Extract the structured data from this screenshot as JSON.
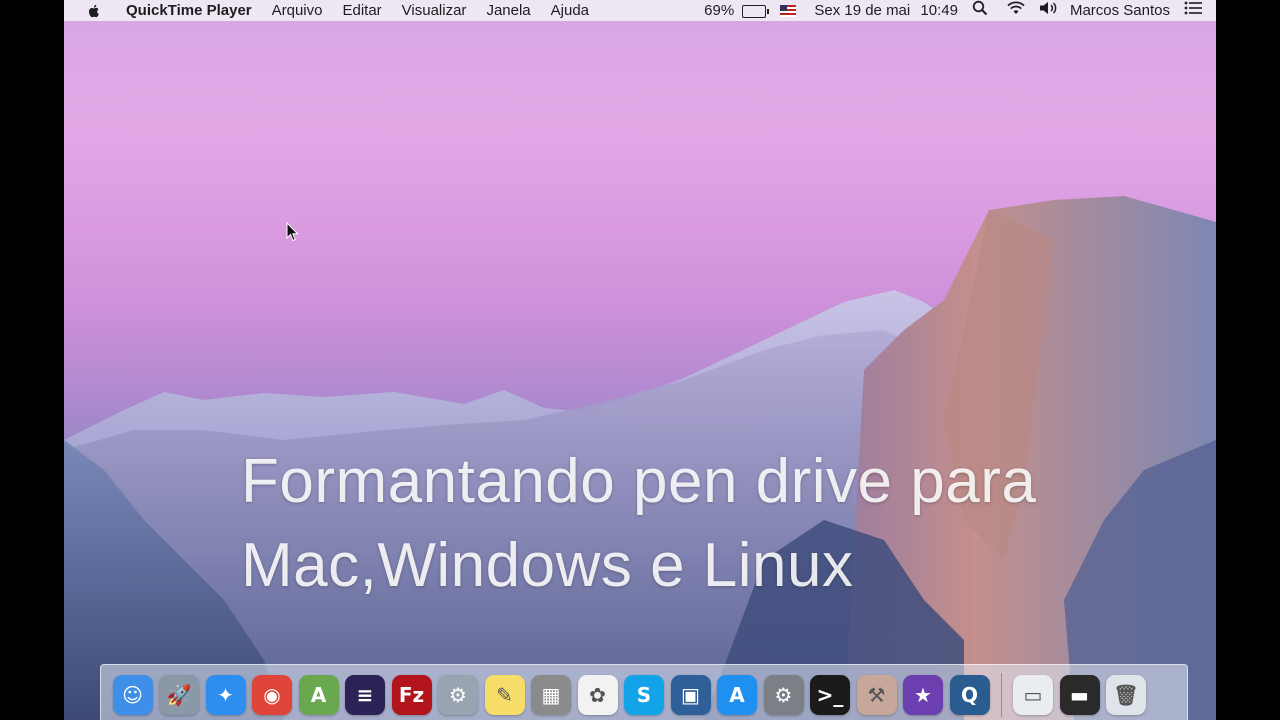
{
  "menubar": {
    "app_name": "QuickTime Player",
    "menus": [
      "Arquivo",
      "Editar",
      "Visualizar",
      "Janela",
      "Ajuda"
    ],
    "battery": "69%",
    "date": "Sex 19 de mai",
    "time": "10:49",
    "user": "Marcos Santos"
  },
  "headline": {
    "line1": "Formantando pen drive para",
    "line2": "Mac,Windows e Linux"
  },
  "dock": {
    "apps": [
      {
        "name": "finder-icon",
        "color": "#3d8fe8",
        "glyph": "☺"
      },
      {
        "name": "launchpad-icon",
        "color": "#8a98a8",
        "glyph": "🚀"
      },
      {
        "name": "safari-icon",
        "color": "#2e8ef0",
        "glyph": "✦"
      },
      {
        "name": "chrome-icon",
        "color": "#e0453a",
        "glyph": "◉"
      },
      {
        "name": "android-studio-icon",
        "color": "#6aa84f",
        "glyph": "A"
      },
      {
        "name": "eclipse-icon",
        "color": "#2c2255",
        "glyph": "≡"
      },
      {
        "name": "filezilla-icon",
        "color": "#b2141c",
        "glyph": "Fz"
      },
      {
        "name": "system-utility-icon",
        "color": "#9aa3b0",
        "glyph": "⚙"
      },
      {
        "name": "notes-icon",
        "color": "#f6dd6a",
        "glyph": "✎"
      },
      {
        "name": "calculator-icon",
        "color": "#8b8b8b",
        "glyph": "▦"
      },
      {
        "name": "photos-icon",
        "color": "#f2f2f2",
        "glyph": "✿"
      },
      {
        "name": "skype-icon",
        "color": "#13a3e8",
        "glyph": "S"
      },
      {
        "name": "virtualbox-icon",
        "color": "#2f5f99",
        "glyph": "▣"
      },
      {
        "name": "app-store-icon",
        "color": "#1f8ff2",
        "glyph": "A"
      },
      {
        "name": "system-preferences-icon",
        "color": "#7b7f86",
        "glyph": "⚙"
      },
      {
        "name": "terminal-icon",
        "color": "#1b1b1b",
        "glyph": ">_"
      },
      {
        "name": "instruments-icon",
        "color": "#c7a79a",
        "glyph": "⚒"
      },
      {
        "name": "imovie-icon",
        "color": "#6b3fb0",
        "glyph": "★"
      },
      {
        "name": "quicktime-icon",
        "color": "#2a5c8f",
        "glyph": "Q"
      }
    ],
    "right": [
      {
        "name": "downloads-stack-icon",
        "color": "#e9edf2",
        "glyph": "▭"
      },
      {
        "name": "screenshot-stack-icon",
        "color": "#2a2a2a",
        "glyph": "▬"
      },
      {
        "name": "trash-icon",
        "color": "#dfe4ea",
        "glyph": "🗑"
      }
    ]
  }
}
